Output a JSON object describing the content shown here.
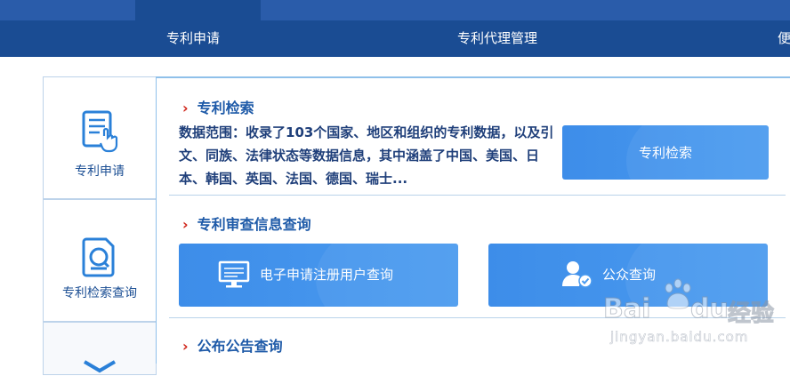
{
  "nav": {
    "items": [
      {
        "label": "专利申请"
      },
      {
        "label": "专利代理管理"
      },
      {
        "label": "便"
      }
    ]
  },
  "sidebar": {
    "tabs": [
      {
        "label": "专利申请",
        "icon": "document-hand-icon"
      },
      {
        "label": "专利检索查询",
        "icon": "search-document-icon"
      },
      {
        "label": "",
        "icon": "mail-icon"
      }
    ]
  },
  "sections": {
    "patent_search": {
      "title": "专利检索",
      "description": "数据范围：收录了103个国家、地区和组织的专利数据，以及引文、同族、法律状态等数据信息，其中涵盖了中国、美国、日本、韩国、英国、法国、德国、瑞士...",
      "button_label": "专利检索"
    },
    "examination": {
      "title": "专利审查信息查询",
      "buttons": [
        {
          "label": "电子申请注册用户查询",
          "icon": "monitor-icon"
        },
        {
          "label": "公众查询",
          "icon": "user-check-icon"
        }
      ]
    },
    "announcement": {
      "title": "公布公告查询"
    }
  },
  "watermark": {
    "brand": "Bai",
    "brand_end": "du",
    "cn": "经验",
    "url": "jingyan.baidu.com"
  },
  "colors": {
    "header_bg": "#1a4c93",
    "header_top": "#2a5caa",
    "accent_blue": "#3d8de9",
    "title_blue": "#1e5aa8",
    "arrow_red": "#d0261b"
  }
}
